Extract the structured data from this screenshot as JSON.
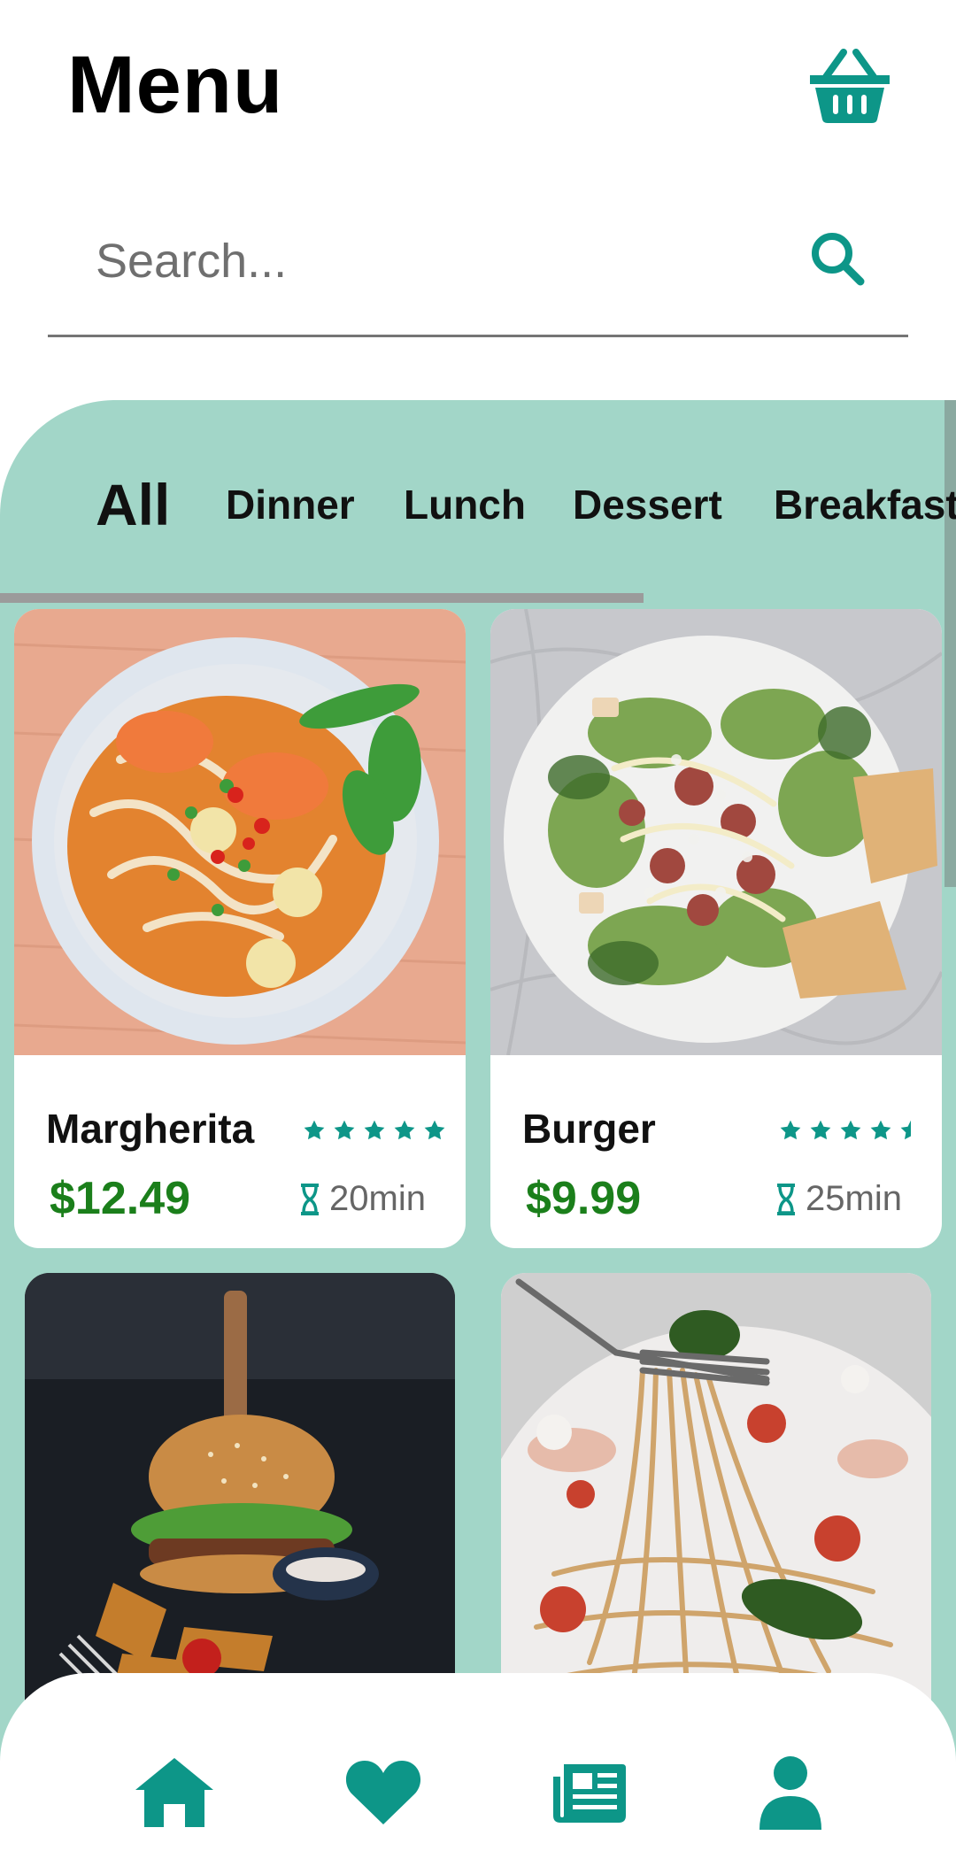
{
  "header": {
    "title": "Menu"
  },
  "search": {
    "placeholder": "Search..."
  },
  "categories": [
    "All",
    "Dinner",
    "Lunch",
    "Dessert",
    "Breakfast"
  ],
  "active_category": "All",
  "colors": {
    "accent": "#0d9688",
    "panel": "#a2d6c8",
    "price": "#1b7f1b"
  },
  "items": [
    {
      "name": "Margherita",
      "price": "$12.49",
      "time": "20min",
      "rating": 5,
      "image": "noodle-soup-bowl"
    },
    {
      "name": "Burger",
      "price": "$9.99",
      "time": "25min",
      "rating": 4.5,
      "image": "caesar-salad-plate"
    },
    {
      "image": "burger-with-fries"
    },
    {
      "image": "spaghetti-on-fork"
    }
  ],
  "nav": [
    "home-icon",
    "heart-icon",
    "newspaper-icon",
    "user-icon"
  ]
}
